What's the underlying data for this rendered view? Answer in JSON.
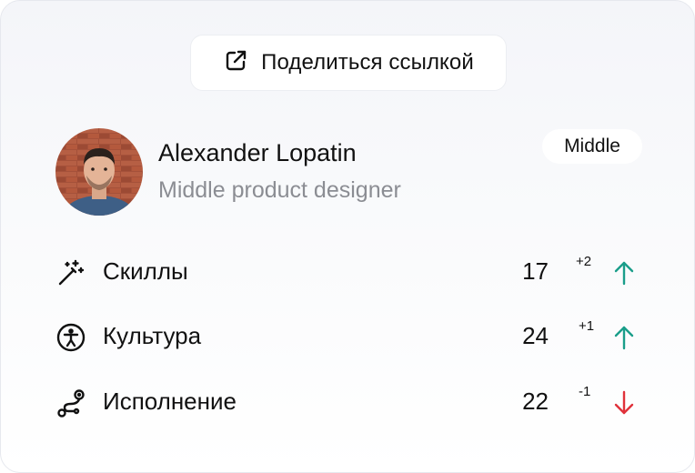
{
  "share_button": {
    "label": "Поделиться ссылкой",
    "icon": "external-link-icon"
  },
  "profile": {
    "name": "Alexander Lopatin",
    "role": "Middle product designer",
    "level": "Middle",
    "avatar": "avatar-photo"
  },
  "metrics": [
    {
      "icon": "magic-wand-icon",
      "label": "Скиллы",
      "value": "17",
      "delta": "+2",
      "trend": "up"
    },
    {
      "icon": "accessibility-icon",
      "label": "Культура",
      "value": "24",
      "delta": "+1",
      "trend": "up"
    },
    {
      "icon": "route-icon",
      "label": "Исполнение",
      "value": "22",
      "delta": "-1",
      "trend": "down"
    }
  ],
  "colors": {
    "up": "#1a9e8a",
    "down": "#e0323b",
    "secondary_text": "#8b8d93"
  }
}
